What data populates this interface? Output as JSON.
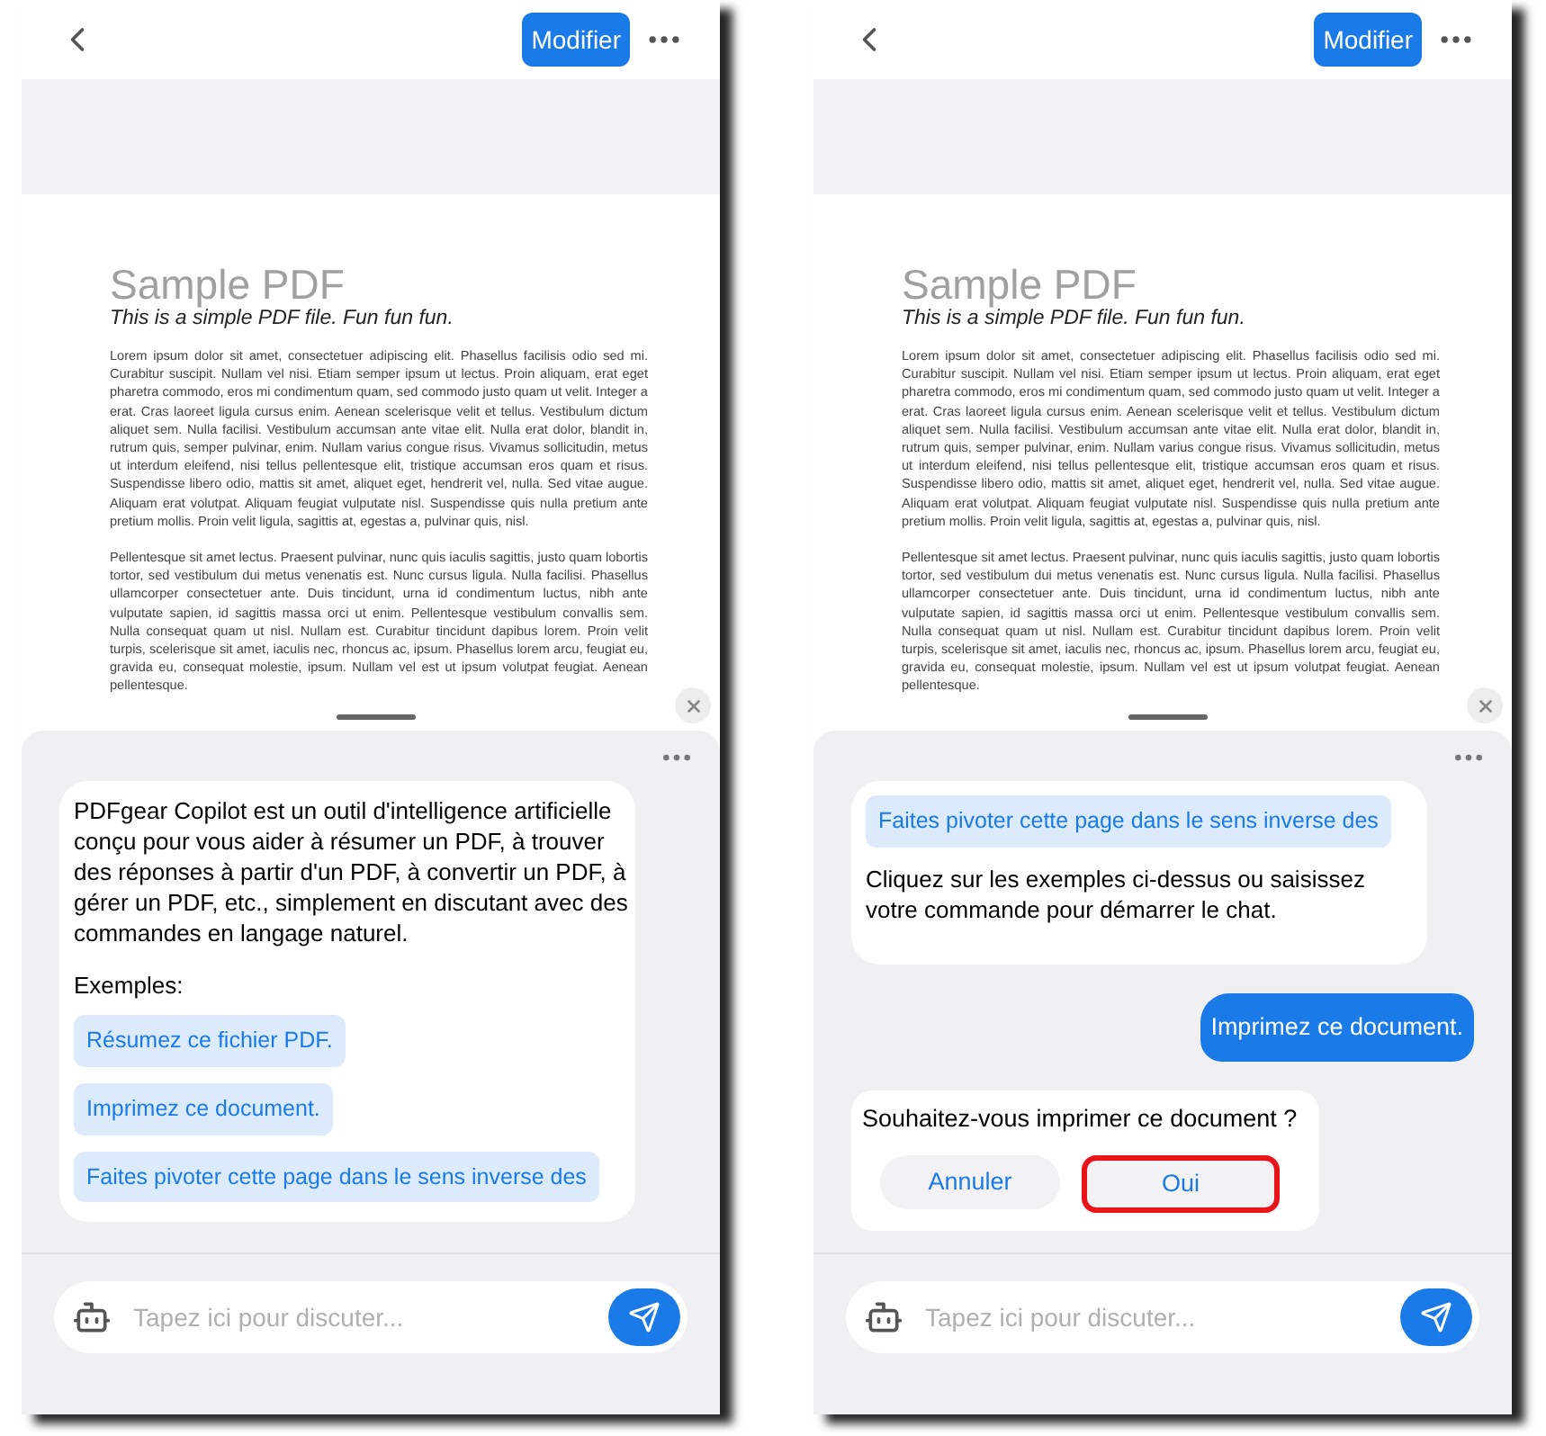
{
  "screens": [
    {
      "top_bar": {
        "edit_button": "Modifier"
      },
      "document": {
        "title": "Sample PDF",
        "subtitle": "This is a simple PDF file. Fun fun fun.",
        "paragraphs": [
          "Lorem ipsum dolor sit amet, consectetuer adipiscing elit. Phasellus facilisis odio sed mi. Curabitur suscipit. Nullam vel nisi. Etiam semper ipsum ut lectus. Proin aliquam, erat eget pharetra commodo, eros mi condimentum quam, sed commodo justo quam ut velit. Integer a erat. Cras laoreet ligula cursus enim. Aenean scelerisque velit et tellus. Vestibulum dictum aliquet sem. Nulla facilisi. Vestibulum accumsan ante vitae elit. Nulla erat dolor, blandit in, rutrum quis, semper pulvinar, enim. Nullam varius congue risus. Vivamus sollicitudin, metus ut interdum eleifend, nisi tellus pellentesque elit, tristique accumsan eros quam et risus. Suspendisse libero odio, mattis sit amet, aliquet eget, hendrerit vel, nulla. Sed vitae augue. Aliquam erat volutpat. Aliquam feugiat vulputate nisl. Suspendisse quis nulla pretium ante pretium mollis. Proin velit ligula, sagittis at, egestas a, pulvinar quis, nisl.",
          "Pellentesque sit amet lectus. Praesent pulvinar, nunc quis iaculis sagittis, justo quam lobortis tortor, sed vestibulum dui metus venenatis est. Nunc cursus ligula. Nulla facilisi. Phasellus ullamcorper consectetuer ante. Duis tincidunt, urna id condimentum luctus, nibh ante vulputate sapien, id sagittis massa orci ut enim. Pellentesque vestibulum convallis sem. Nulla consequat quam ut nisl. Nullam est. Curabitur tincidunt dapibus lorem. Proin velit turpis, scelerisque sit amet, iaculis nec, rhoncus ac, ipsum. Phasellus lorem arcu, feugiat eu, gravida eu, consequat molestie, ipsum. Nullam vel est ut ipsum volutpat feugiat. Aenean pellentesque."
        ]
      },
      "chat": {
        "messages": [
          {
            "kind": "bot",
            "parts": [
              {
                "kind": "text",
                "text": "PDFgear Copilot est un outil d'intelligence artificielle conçu pour vous aider à résumer un PDF, à trouver des réponses à partir d'un PDF, à convertir un PDF, à gérer un PDF, etc., simplement en discutant avec des commandes en langage naturel."
              },
              {
                "kind": "label",
                "text": "Exemples:"
              },
              {
                "kind": "example",
                "text": "Résumez ce fichier PDF."
              },
              {
                "kind": "example",
                "text": "Imprimez ce document."
              },
              {
                "kind": "example",
                "text": "Faites pivoter cette page dans le sens inverse des"
              }
            ]
          }
        ]
      },
      "input": {
        "placeholder": "Tapez ici pour discuter..."
      }
    },
    {
      "top_bar": {
        "edit_button": "Modifier"
      },
      "document": {
        "title": "Sample PDF",
        "subtitle": "This is a simple PDF file. Fun fun fun.",
        "paragraphs": [
          "Lorem ipsum dolor sit amet, consectetuer adipiscing elit. Phasellus facilisis odio sed mi. Curabitur suscipit. Nullam vel nisi. Etiam semper ipsum ut lectus. Proin aliquam, erat eget pharetra commodo, eros mi condimentum quam, sed commodo justo quam ut velit. Integer a erat. Cras laoreet ligula cursus enim. Aenean scelerisque velit et tellus. Vestibulum dictum aliquet sem. Nulla facilisi. Vestibulum accumsan ante vitae elit. Nulla erat dolor, blandit in, rutrum quis, semper pulvinar, enim. Nullam varius congue risus. Vivamus sollicitudin, metus ut interdum eleifend, nisi tellus pellentesque elit, tristique accumsan eros quam et risus. Suspendisse libero odio, mattis sit amet, aliquet eget, hendrerit vel, nulla. Sed vitae augue. Aliquam erat volutpat. Aliquam feugiat vulputate nisl. Suspendisse quis nulla pretium ante pretium mollis. Proin velit ligula, sagittis at, egestas a, pulvinar quis, nisl.",
          "Pellentesque sit amet lectus. Praesent pulvinar, nunc quis iaculis sagittis, justo quam lobortis tortor, sed vestibulum dui metus venenatis est. Nunc cursus ligula. Nulla facilisi. Phasellus ullamcorper consectetuer ante. Duis tincidunt, urna id condimentum luctus, nibh ante vulputate sapien, id sagittis massa orci ut enim. Pellentesque vestibulum convallis sem. Nulla consequat quam ut nisl. Nullam est. Curabitur tincidunt dapibus lorem. Proin velit turpis, scelerisque sit amet, iaculis nec, rhoncus ac, ipsum. Phasellus lorem arcu, feugiat eu, gravida eu, consequat molestie, ipsum. Nullam vel est ut ipsum volutpat feugiat. Aenean pellentesque."
        ]
      },
      "chat": {
        "messages": [
          {
            "kind": "bot",
            "parts": [
              {
                "kind": "example",
                "text": "Faites pivoter cette page dans le sens inverse des"
              },
              {
                "kind": "text",
                "text": "Cliquez sur les exemples ci-dessus ou saisissez votre commande pour démarrer le chat."
              }
            ]
          },
          {
            "kind": "user",
            "text": "Imprimez ce document."
          },
          {
            "kind": "confirm",
            "question": "Souhaitez-vous imprimer ce document ?",
            "buttons": [
              {
                "label": "Annuler",
                "highlighted": false
              },
              {
                "label": "Oui",
                "highlighted": true
              }
            ]
          }
        ]
      },
      "input": {
        "placeholder": "Tapez ici pour discuter..."
      }
    }
  ]
}
